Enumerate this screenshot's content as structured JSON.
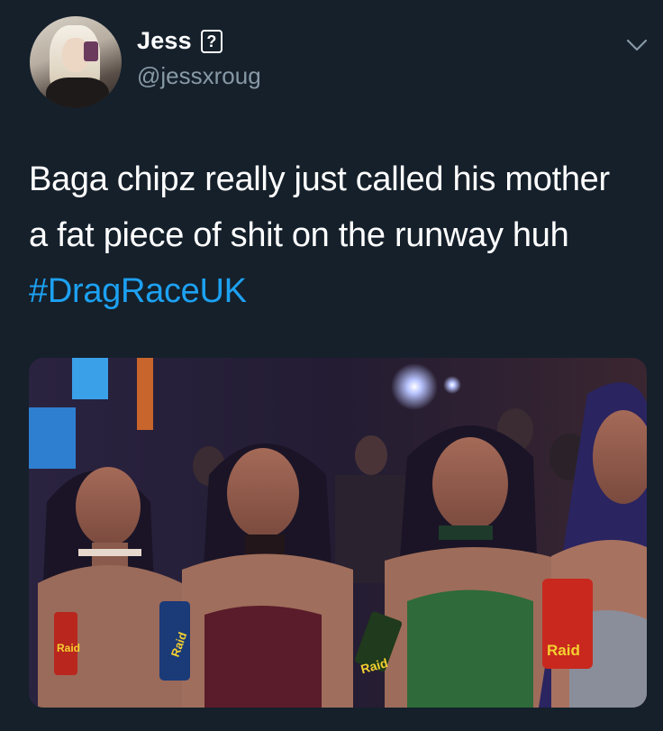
{
  "tweet": {
    "author": {
      "display_name": "Jess",
      "name_emoji_placeholder": "?",
      "handle": "@jessxroug",
      "avatar_icon": "profile-avatar"
    },
    "text_main": "Baga chipz really just called his mother a fat piece of shit on the runway huh ",
    "hashtag": "#DragRaceUK",
    "media": {
      "type": "photo",
      "product_labels": [
        "Raid",
        "Raid",
        "Raid",
        "Raid"
      ]
    },
    "menu_icon": "chevron-down-icon"
  },
  "colors": {
    "background": "#15202b",
    "text": "#ffffff",
    "secondary_text": "#8899a6",
    "link": "#1da1f2"
  }
}
